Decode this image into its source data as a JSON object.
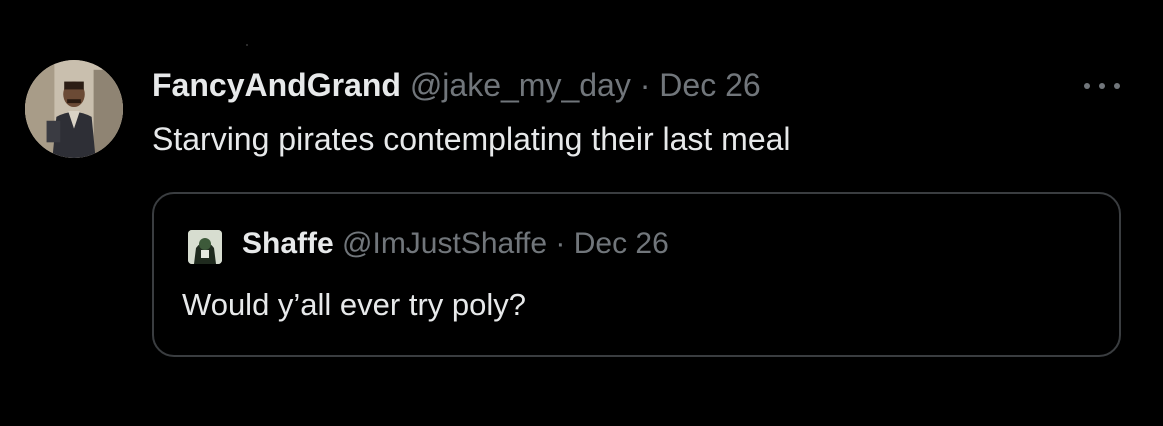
{
  "tweet": {
    "author": {
      "display_name": "FancyAndGrand",
      "handle": "@jake_my_day"
    },
    "separator": "·",
    "date": "Dec 26",
    "text": "Starving pirates contemplating their last meal",
    "more_icon": "more-horizontal-icon"
  },
  "quoted_tweet": {
    "author": {
      "display_name": "Shaffe",
      "handle": "@ImJustShaffe"
    },
    "separator": "·",
    "date": "Dec 26",
    "text": "Would y’all ever try poly?"
  },
  "colors": {
    "background": "#000000",
    "primary_text": "#e7e9ea",
    "secondary_text": "#71767b",
    "border": "#3a3d40"
  }
}
